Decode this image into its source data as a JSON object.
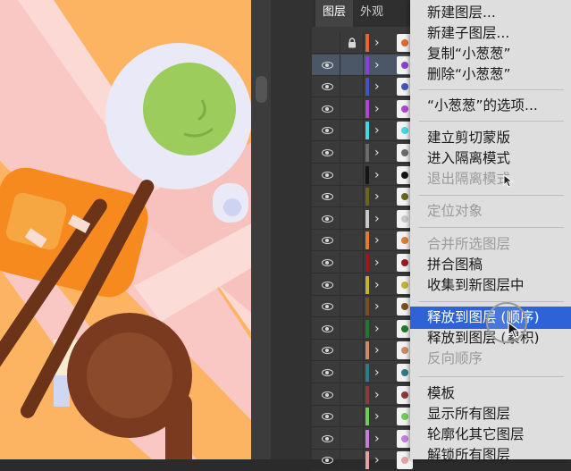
{
  "panel": {
    "tabs": [
      {
        "label": "图层",
        "active": true
      },
      {
        "label": "外观",
        "active": false
      }
    ],
    "rows": [
      {
        "color": "#e8672c",
        "selected": false,
        "lock_row": true
      },
      {
        "color": "#8b3fd8",
        "selected": true
      },
      {
        "color": "#4055c0"
      },
      {
        "color": "#b343d8"
      },
      {
        "color": "#47d6e6"
      },
      {
        "color": "#6b6b6b"
      },
      {
        "color": "#151515"
      },
      {
        "color": "#6b6518"
      },
      {
        "color": "#c9c9c9"
      },
      {
        "color": "#e47b32"
      },
      {
        "color": "#9b1b1b"
      },
      {
        "color": "#c7b230"
      },
      {
        "color": "#7a4f1e"
      },
      {
        "color": "#1d7a2b"
      },
      {
        "color": "#d08a62"
      },
      {
        "color": "#2a7e8a"
      },
      {
        "color": "#8c3a3a"
      },
      {
        "color": "#6bd04f"
      },
      {
        "color": "#c77de0"
      },
      {
        "color": "#e8a0a0"
      }
    ]
  },
  "menu": {
    "items": [
      {
        "label": "新建图层...",
        "state": "enabled"
      },
      {
        "label": "新建子图层...",
        "state": "enabled"
      },
      {
        "label": "复制“小葱葱”",
        "state": "enabled"
      },
      {
        "label": "删除“小葱葱”",
        "state": "enabled"
      },
      {
        "label": "“小葱葱”的选项...",
        "state": "enabled"
      },
      {
        "label": "建立剪切蒙版",
        "state": "enabled"
      },
      {
        "label": "进入隔离模式",
        "state": "enabled"
      },
      {
        "label": "退出隔离模式",
        "state": "disabled"
      },
      {
        "label": "定位对象",
        "state": "disabled"
      },
      {
        "label": "合并所选图层",
        "state": "disabled"
      },
      {
        "label": "拼合图稿",
        "state": "enabled"
      },
      {
        "label": "收集到新图层中",
        "state": "enabled"
      },
      {
        "label": "释放到图层 (顺序)",
        "state": "highlighted"
      },
      {
        "label": "释放到图层 (累积)",
        "state": "enabled"
      },
      {
        "label": "反向顺序",
        "state": "disabled"
      },
      {
        "label": "模板",
        "state": "enabled"
      },
      {
        "label": "显示所有图层",
        "state": "enabled"
      },
      {
        "label": "轮廓化其它图层",
        "state": "enabled"
      },
      {
        "label": "解锁所有图层",
        "state": "enabled"
      }
    ]
  },
  "colors": {
    "canvas_bg": "#fdb462",
    "menu_bg": "#dedede",
    "menu_highlight": "#2e63d8",
    "panel_bg": "#3a3a3a"
  },
  "icons": {
    "eye": "eye-icon",
    "lock": "lock-icon",
    "expand": "chevron-right-icon",
    "cursor": "pointer-cursor-icon"
  }
}
